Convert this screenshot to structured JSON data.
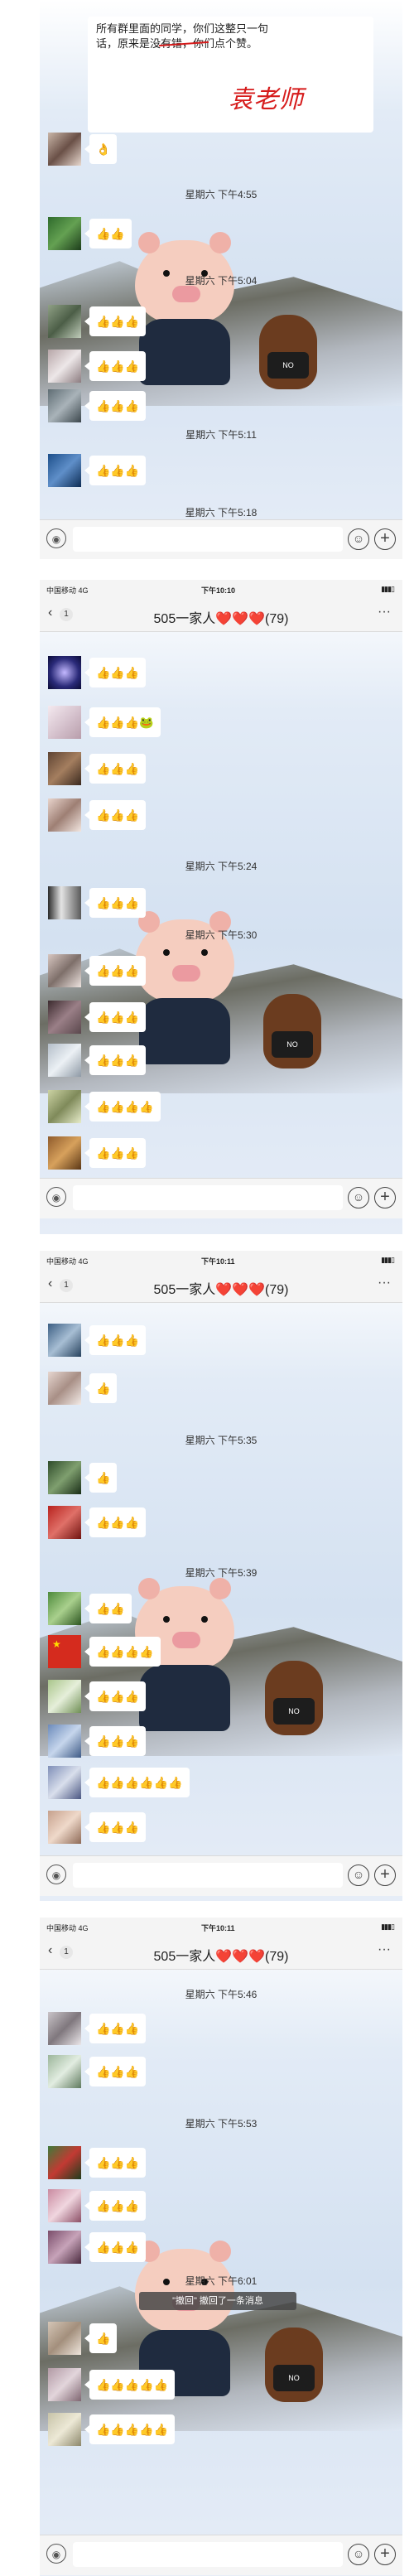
{
  "screen1": {
    "status": {
      "carrier": ""
    },
    "pinned_text": "所有群里面的同学，你们这整只一句话，原来是没有错，你们点个赞。",
    "signature": "袁老师",
    "timestamps": [
      "星期六 下午4:55",
      "星期六 下午5:04",
      "星期六 下午5:11",
      "星期六 下午5:18"
    ],
    "messages": [
      "👌",
      "👍👍",
      "👍👍👍",
      "👍👍👍",
      "👍👍👍",
      "👍👍👍"
    ]
  },
  "screen2": {
    "status": {
      "carrier": "中国移动 4G",
      "time": "下午10:10"
    },
    "nav": {
      "back": "‹",
      "unread": "1",
      "title": "505一家人❤️❤️❤️(79)",
      "more": "···"
    },
    "timestamps": [
      "星期六 下午5:24",
      "星期六 下午5:30"
    ],
    "messages": [
      "👍👍👍",
      "👍👍👍🐸",
      "👍👍👍",
      "👍👍👍",
      "👍👍👍",
      "👍👍👍",
      "👍👍👍",
      "👍👍👍",
      "👍👍👍👍",
      "👍👍👍"
    ]
  },
  "screen3": {
    "status": {
      "carrier": "中国移动 4G",
      "time": "下午10:11"
    },
    "nav": {
      "back": "‹",
      "unread": "1",
      "title": "505一家人❤️❤️❤️(79)",
      "more": "···"
    },
    "timestamps": [
      "星期六 下午5:35",
      "星期六 下午5:39"
    ],
    "messages": [
      "👍👍👍",
      "👍",
      "👍",
      "👍👍👍",
      "👍👍",
      "👍👍👍👍",
      "👍👍👍",
      "👍👍👍",
      "👍👍👍👍👍👍",
      "👍👍👍"
    ]
  },
  "screen4": {
    "status": {
      "carrier": "中国移动 4G",
      "time": "下午10:11"
    },
    "nav": {
      "back": "‹",
      "unread": "1",
      "title": "505一家人❤️❤️❤️(79)",
      "more": "···"
    },
    "timestamps": [
      "星期六 下午5:46",
      "星期六 下午5:53",
      "星期六 下午6:01"
    ],
    "toast": "\"撤回\" 撤回了一条消息",
    "messages": [
      "👍👍👍",
      "👍👍👍",
      "👍👍👍",
      "👍👍👍",
      "👍👍👍",
      "👍",
      "👍👍👍👍👍",
      "👍👍👍👍👍"
    ]
  },
  "icons": {
    "voice": "voice-icon",
    "emoji": "emoji-icon",
    "plus": "plus-icon",
    "back": "chevron-left-icon",
    "more": "more-icon"
  },
  "colors": {
    "bubble": "#ffffff",
    "thumbs": "#c98a12",
    "signature": "#d61b1b",
    "background": "#d4e1f1"
  }
}
